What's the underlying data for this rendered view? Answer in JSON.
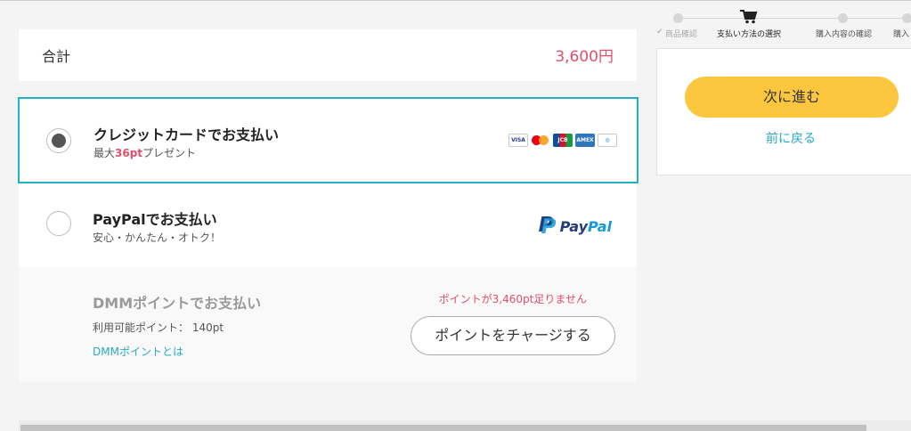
{
  "total": {
    "label": "合計",
    "amount": "3,600円"
  },
  "payment": {
    "credit_card": {
      "title": "クレジットカードでお支払い",
      "sub_prefix": "最大",
      "sub_points": "36pt",
      "sub_suffix": "プレゼント",
      "selected": true,
      "cards": [
        "VISA",
        "MC",
        "JCB",
        "AMEX",
        "Diners"
      ]
    },
    "paypal": {
      "title": "PayPalでお支払い",
      "sub": "安心・かんたん・オトク！",
      "logo_dark": "Pay",
      "logo_light": "Pal"
    },
    "dmm": {
      "title": "DMMポイントでお支払い",
      "available": "利用可能ポイント： 140pt",
      "link": "DMMポイントとは",
      "warning": "ポイントが3,460pt足りません",
      "charge_button": "ポイントをチャージする"
    }
  },
  "steps": [
    {
      "label": "商品確認",
      "state": "done"
    },
    {
      "label": "支払い方法の選択",
      "state": "active"
    },
    {
      "label": "購入内容の確認",
      "state": "upcoming"
    },
    {
      "label": "購入",
      "state": "upcoming"
    }
  ],
  "side": {
    "next_button": "次に進む",
    "back_link": "前に戻る"
  },
  "colors": {
    "accent": "#20b2c4",
    "price": "#e0506b",
    "primary_button": "#fcc63f",
    "link": "#2aa9c1"
  }
}
